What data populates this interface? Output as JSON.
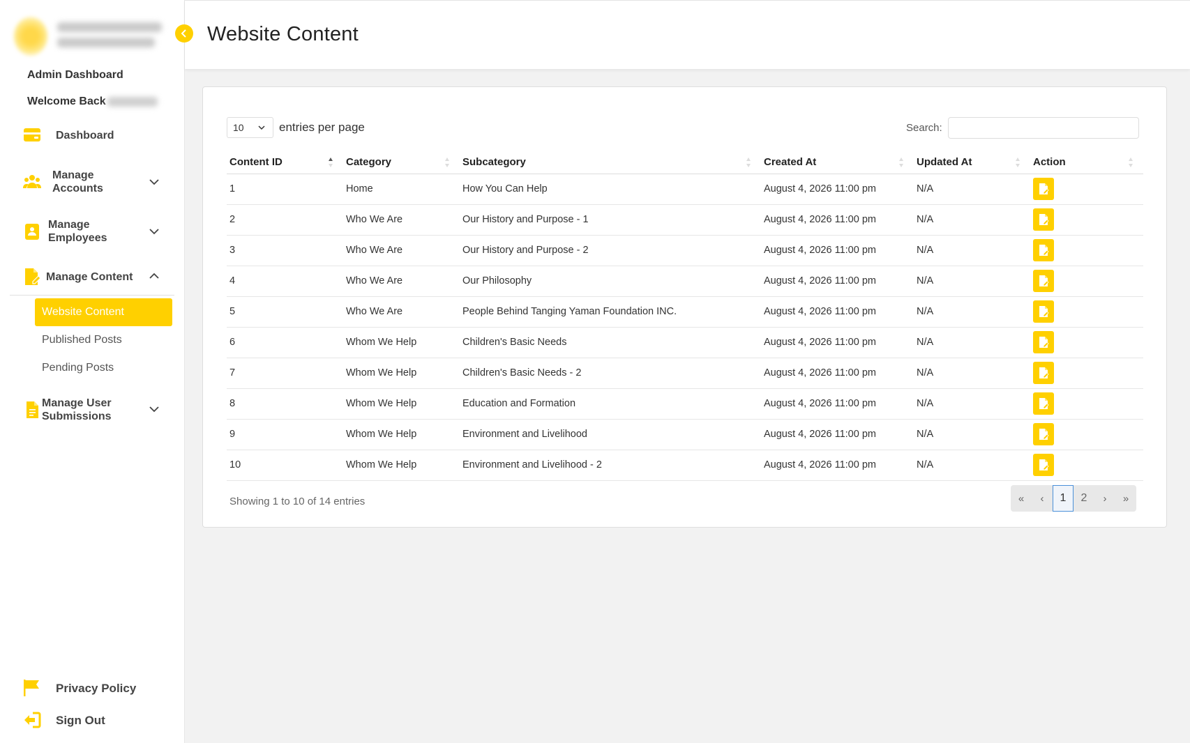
{
  "sidebar": {
    "admin_title": "Admin Dashboard",
    "welcome": "Welcome Back",
    "nav": {
      "dashboard": "Dashboard",
      "manage_accounts": [
        "Manage",
        "Accounts"
      ],
      "manage_employees": [
        "Manage",
        "Employees"
      ],
      "manage_content": "Manage Content",
      "manage_user_submissions": [
        "Manage User",
        "Submissions"
      ]
    },
    "content_subitems": [
      "Website Content",
      "Published Posts",
      "Pending Posts"
    ],
    "footer": {
      "privacy_policy": "Privacy Policy",
      "sign_out": "Sign Out"
    }
  },
  "header": {
    "title": "Website Content"
  },
  "table_controls": {
    "entries_value": "10",
    "entries_label": "entries per page",
    "search_label": "Search:",
    "search_value": ""
  },
  "table": {
    "columns": [
      "Content ID",
      "Category",
      "Subcategory",
      "Created At",
      "Updated At",
      "Action"
    ],
    "rows": [
      {
        "id": "1",
        "category": "Home",
        "subcategory": "How You Can Help",
        "created": "August 4, 2026 11:00 pm",
        "updated": "N/A"
      },
      {
        "id": "2",
        "category": "Who We Are",
        "subcategory": "Our History and Purpose - 1",
        "created": "August 4, 2026 11:00 pm",
        "updated": "N/A"
      },
      {
        "id": "3",
        "category": "Who We Are",
        "subcategory": "Our History and Purpose - 2",
        "created": "August 4, 2026 11:00 pm",
        "updated": "N/A"
      },
      {
        "id": "4",
        "category": "Who We Are",
        "subcategory": "Our Philosophy",
        "created": "August 4, 2026 11:00 pm",
        "updated": "N/A"
      },
      {
        "id": "5",
        "category": "Who We Are",
        "subcategory": "People Behind Tanging Yaman Foundation INC.",
        "created": "August 4, 2026 11:00 pm",
        "updated": "N/A"
      },
      {
        "id": "6",
        "category": "Whom We Help",
        "subcategory": "Children's Basic Needs",
        "created": "August 4, 2026 11:00 pm",
        "updated": "N/A"
      },
      {
        "id": "7",
        "category": "Whom We Help",
        "subcategory": "Children's Basic Needs - 2",
        "created": "August 4, 2026 11:00 pm",
        "updated": "N/A"
      },
      {
        "id": "8",
        "category": "Whom We Help",
        "subcategory": "Education and Formation",
        "created": "August 4, 2026 11:00 pm",
        "updated": "N/A"
      },
      {
        "id": "9",
        "category": "Whom We Help",
        "subcategory": "Environment and Livelihood",
        "created": "August 4, 2026 11:00 pm",
        "updated": "N/A"
      },
      {
        "id": "10",
        "category": "Whom We Help",
        "subcategory": "Environment and Livelihood - 2",
        "created": "August 4, 2026 11:00 pm",
        "updated": "N/A"
      }
    ],
    "action_icon": "edit-icon"
  },
  "footer": {
    "showing": "Showing 1 to 10 of 14 entries",
    "pager": {
      "first": "«",
      "prev": "‹",
      "pages": [
        "1",
        "2"
      ],
      "current": "1",
      "next": "›",
      "last": "»"
    }
  },
  "colors": {
    "accent": "#ffd000",
    "sidebar_bg": "#ffffff",
    "page_bg": "#f2f2f2"
  }
}
